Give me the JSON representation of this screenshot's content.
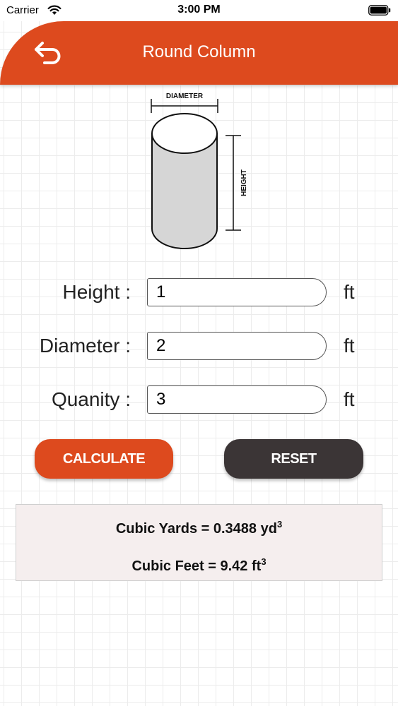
{
  "status_bar": {
    "carrier": "Carrier",
    "time": "3:00 PM"
  },
  "header": {
    "title": "Round Column",
    "back_icon": "back-arrow-icon",
    "color": "#dd4a1e"
  },
  "diagram": {
    "diameter_label": "DIAMETER",
    "height_label": "HEIGHT"
  },
  "form": {
    "height": {
      "label": "Height :",
      "value": "1",
      "unit": "ft"
    },
    "diameter": {
      "label": "Diameter :",
      "value": "2",
      "unit": "ft"
    },
    "quantity": {
      "label": "Quanity :",
      "value": "3",
      "unit": "ft"
    }
  },
  "buttons": {
    "calculate": "CALCULATE",
    "reset": "RESET",
    "calculate_color": "#dd4a1e",
    "reset_color": "#3b3536"
  },
  "results": {
    "cubic_yards_label": "Cubic Yards = ",
    "cubic_yards_value": "0.3488",
    "cubic_yards_unit": "yd",
    "cubic_feet_label": "Cubic Feet = ",
    "cubic_feet_value": "9.42",
    "cubic_feet_unit": "ft",
    "exponent": "3"
  }
}
